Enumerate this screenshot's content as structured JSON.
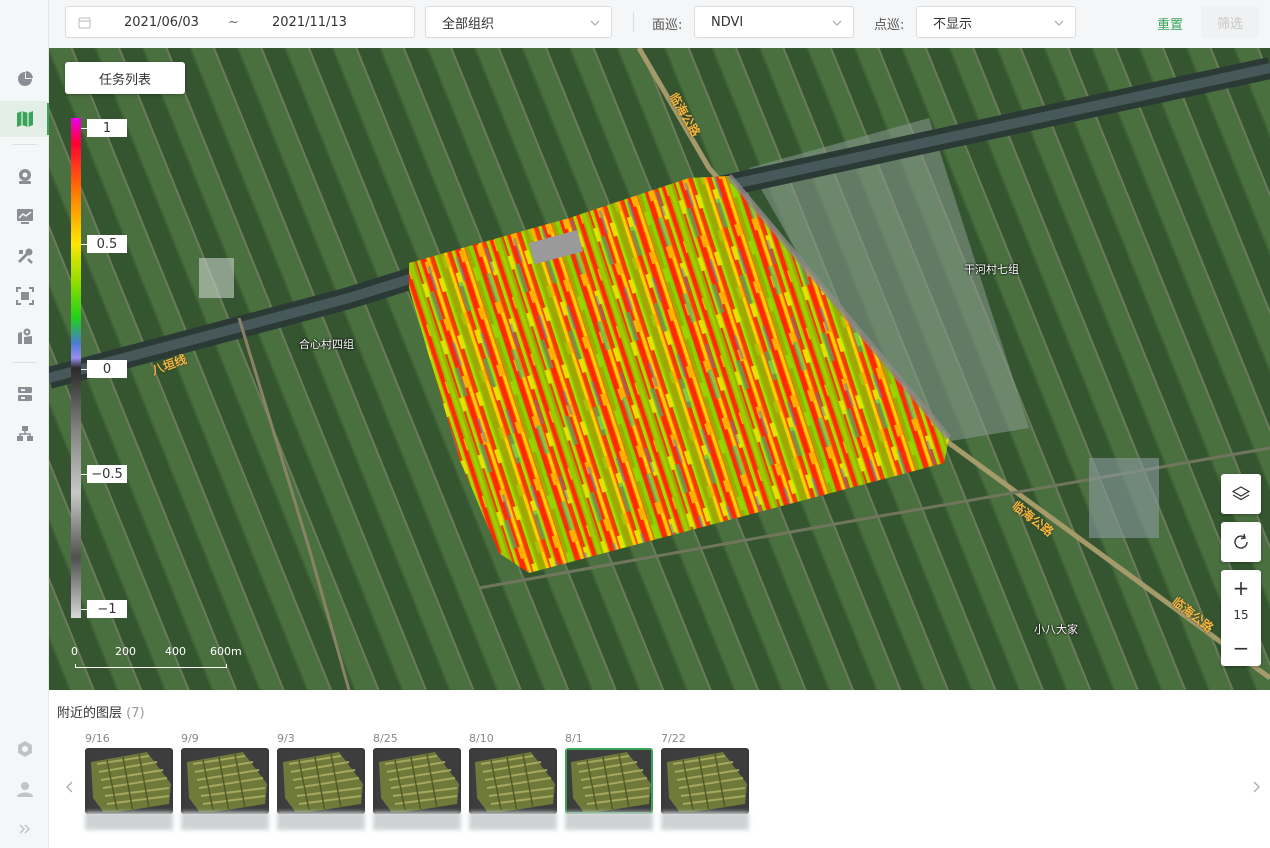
{
  "sidebar": {
    "items": [
      {
        "name": "sidebar-item-overview",
        "icon": "pie-chart-icon"
      },
      {
        "name": "sidebar-item-map",
        "icon": "map-icon",
        "active": true
      },
      {
        "name": "sidebar-item-camera",
        "icon": "camera-icon"
      },
      {
        "name": "sidebar-item-monitor",
        "icon": "monitor-chart-icon"
      },
      {
        "name": "sidebar-item-tools",
        "icon": "tools-icon"
      },
      {
        "name": "sidebar-item-scan",
        "icon": "scan-icon"
      },
      {
        "name": "sidebar-item-location",
        "icon": "map-pin-icon"
      },
      {
        "name": "sidebar-item-storage",
        "icon": "storage-icon"
      },
      {
        "name": "sidebar-item-org",
        "icon": "org-tree-icon"
      },
      {
        "name": "sidebar-item-settings",
        "icon": "gear-icon"
      },
      {
        "name": "sidebar-item-user",
        "icon": "user-icon"
      },
      {
        "name": "sidebar-expand",
        "icon": "double-chevron-right-icon"
      }
    ]
  },
  "filters": {
    "date_start": "2021/06/03",
    "date_sep": "~",
    "date_end": "2021/11/13",
    "org_select": "全部组织",
    "area_label": "面巡:",
    "area_select": "NDVI",
    "point_label": "点巡:",
    "point_select": "不显示",
    "reset_label": "重置",
    "filter_label": "筛选"
  },
  "map": {
    "task_list_label": "任务列表",
    "legend": {
      "values": [
        "1",
        "0.5",
        "0",
        "−0.5",
        "−1"
      ]
    },
    "scale": {
      "ticks": [
        "0",
        "200",
        "400",
        "600m"
      ]
    },
    "zoom_level": "15",
    "labels": [
      {
        "text": "干河村七组"
      },
      {
        "text": "合心村四组"
      },
      {
        "text": "小八大家"
      }
    ],
    "road_labels": [
      {
        "text": "临海公路"
      },
      {
        "text": "八垣线"
      },
      {
        "text": "临海公路"
      },
      {
        "text": "临海公路"
      }
    ]
  },
  "nearby": {
    "title": "附近的图层",
    "count": "(7)",
    "layers": [
      {
        "date": "9/16",
        "selected": false
      },
      {
        "date": "9/9",
        "selected": false
      },
      {
        "date": "9/3",
        "selected": false
      },
      {
        "date": "8/25",
        "selected": false
      },
      {
        "date": "8/10",
        "selected": false
      },
      {
        "date": "8/1",
        "selected": true
      },
      {
        "date": "7/22",
        "selected": false
      }
    ]
  }
}
